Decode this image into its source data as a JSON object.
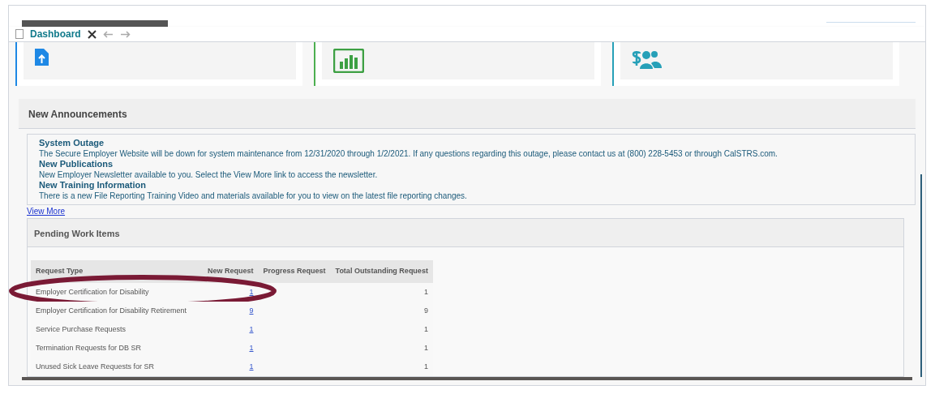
{
  "tabs": [
    {
      "label": "Dashboard",
      "selected": true
    }
  ],
  "announcements": {
    "title": "New Announcements",
    "items": [
      {
        "heading": "System Outage",
        "body": "The Secure Employer Website will be down for system maintenance from 12/31/2020 through 1/2/2021. If any questions regarding this outage, please contact us at (800) 228-5453 or through CalSTRS.com."
      },
      {
        "heading": "New Publications",
        "body": "New Employer Newsletter available to you. Select the View More link to access the newsletter."
      },
      {
        "heading": "New Training Information",
        "body": "There is a new File Reporting Training Video and materials available for you to view on the latest file reporting changes."
      }
    ],
    "link": "View More"
  },
  "pending": {
    "title": "Pending Work Items",
    "columns": [
      "Request Type",
      "New Request",
      "Progress Request",
      "Total Outstanding Request"
    ],
    "rows": [
      {
        "type": "Employer Certification for Disability",
        "new": "1",
        "total": "1",
        "circled": true
      },
      {
        "type": "Employer Certification for Disability Retirement",
        "new": "9",
        "total": "9",
        "circled": false
      },
      {
        "type": "Service Purchase Requests",
        "new": "1",
        "total": "1",
        "circled": false
      },
      {
        "type": "Termination Requests for DB SR",
        "new": "1",
        "total": "1",
        "circled": false
      },
      {
        "type": "Unused Sick Leave Requests for SR",
        "new": "1",
        "total": "1",
        "circled": false
      }
    ]
  }
}
